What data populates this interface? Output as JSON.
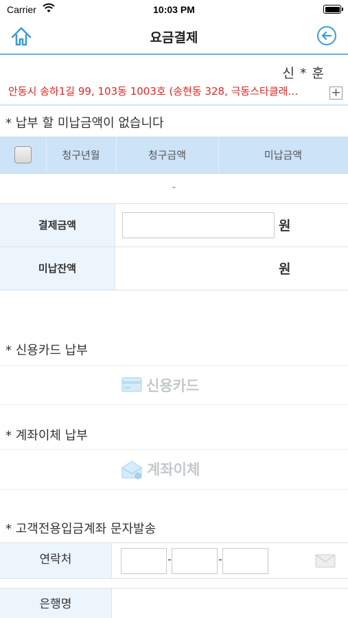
{
  "status_bar": {
    "carrier": "Carrier",
    "time": "10:03 PM"
  },
  "nav": {
    "title": "요금결제",
    "home_icon": "home-icon",
    "back_icon": "back-arrow-icon"
  },
  "customer": {
    "name": "신 * 훈",
    "address": "안동시 송하1길 99, 103동 1003호 (송현동 328, 극동스타클래…",
    "expand_label": "+"
  },
  "unpaid": {
    "notice": "* 납부 할 미납금액이 없습니다",
    "columns": [
      "청구년월",
      "청구금액",
      "미납금액"
    ],
    "empty_row": "-"
  },
  "payment": {
    "amount_label": "결제금액",
    "amount_value": "",
    "amount_unit": "원",
    "balance_label": "미납잔액",
    "balance_value": "",
    "balance_unit": "원"
  },
  "card": {
    "section": "* 신용카드 납부",
    "button_label": "신용카드"
  },
  "transfer": {
    "section": "* 계좌이체 납부",
    "button_label": "계좌이체"
  },
  "sms": {
    "section": "* 고객전용입금계좌 문자발송",
    "contact_label": "연락처",
    "phone_parts": [
      "",
      "",
      ""
    ],
    "dash": "-",
    "bank_label": "은행명"
  },
  "colors": {
    "accent": "#5ab5e6",
    "address": "#e02525",
    "table_header": "#cde3f8",
    "label_bg": "#ecf4fc"
  }
}
